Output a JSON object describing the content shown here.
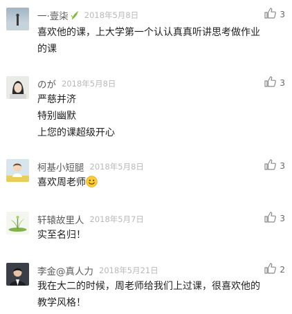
{
  "comments": [
    {
      "username": "一·壹柒",
      "badge_icon": "leaf-badge-icon",
      "date": "2018年5月8日",
      "likes": "3",
      "lines": [
        "喜欢他的课，上大学第一个认认真真听讲思考做作业",
        "的课"
      ]
    },
    {
      "username": "のが",
      "date": "2018年5月8日",
      "likes": "3",
      "lines": [
        "严慈并济",
        "特别幽默",
        "上您的课超级开心"
      ]
    },
    {
      "username": "柯基小短腿",
      "date": "2018年5月8日",
      "likes": "3",
      "lines": [
        "喜欢周老师"
      ],
      "emoji_icon": "smiley-emoji-icon"
    },
    {
      "username": "轩辕故里人",
      "date": "2018年5月7日",
      "likes": "3",
      "lines": [
        "实至名归！"
      ]
    },
    {
      "username": "李金@真人力",
      "date": "2018年5月21日",
      "likes": "2",
      "lines": [
        "我在大二的时候，周老师给我们上过课，很喜欢他的",
        "教学风格！"
      ]
    }
  ],
  "colors": {
    "username": "#5b5b5b",
    "date": "#b8b8b8",
    "text": "#1f1f1f",
    "like_icon": "#888888",
    "badge": "#8cc152"
  }
}
